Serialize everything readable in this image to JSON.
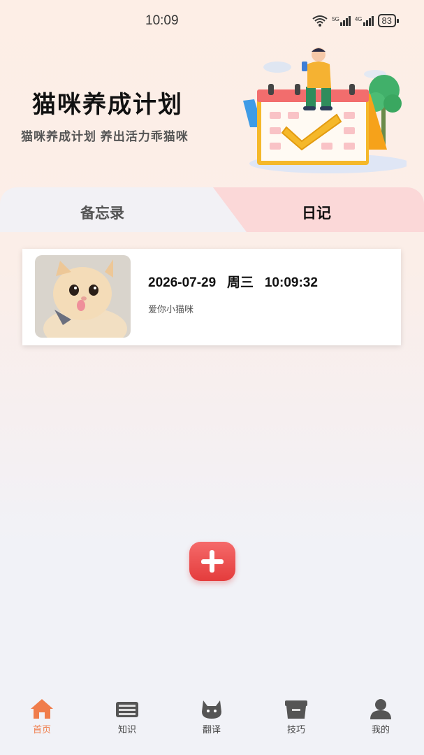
{
  "status": {
    "time": "10:09",
    "battery": "83",
    "net1": "5G",
    "net2": "4G"
  },
  "header": {
    "title": "猫咪养成计划",
    "subtitle": "猫咪养成计划  养出活力乖猫咪"
  },
  "tabs": [
    {
      "label": "备忘录",
      "active": false
    },
    {
      "label": "日记",
      "active": true
    }
  ],
  "entries": [
    {
      "date": "2026-07-29   周三   10:09:32",
      "text": "爱你小猫咪"
    }
  ],
  "nav": [
    {
      "label": "首页",
      "icon": "home-icon",
      "active": true
    },
    {
      "label": "知识",
      "icon": "books-icon",
      "active": false
    },
    {
      "label": "翻译",
      "icon": "cat-icon",
      "active": false
    },
    {
      "label": "技巧",
      "icon": "box-icon",
      "active": false
    },
    {
      "label": "我的",
      "icon": "user-icon",
      "active": false
    }
  ],
  "colors": {
    "accent": "#f07d4b",
    "add_button": "#e43c3c",
    "tab_active_bg": "#fbd8d8"
  }
}
